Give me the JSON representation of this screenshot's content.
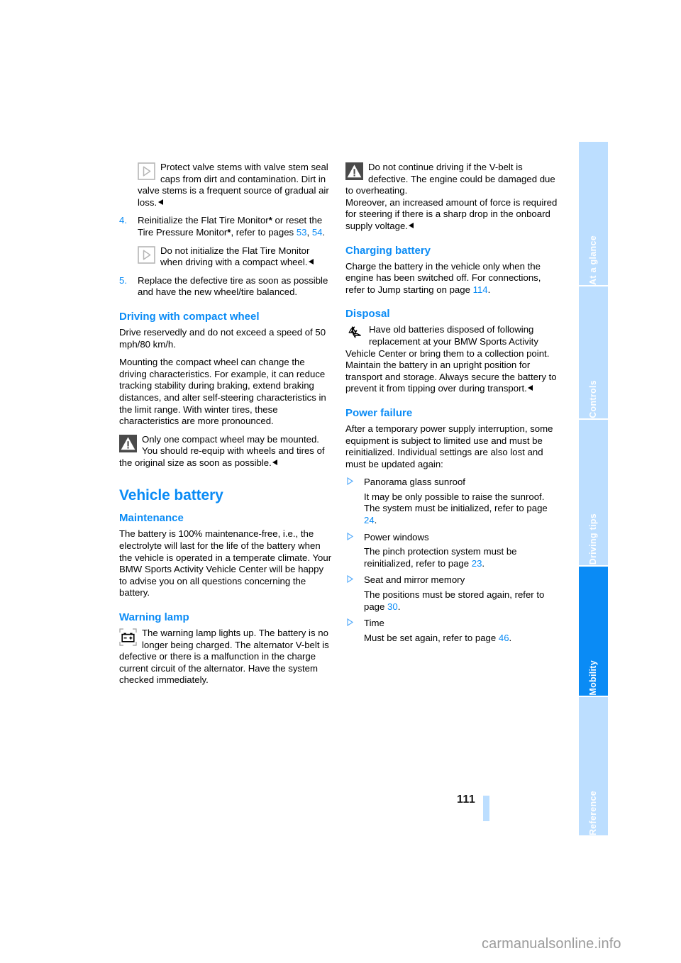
{
  "page": {
    "number": "111",
    "watermark": "carmanualsonline.info"
  },
  "colors": {
    "accent": "#0a8bf5",
    "tab_inactive": "#bcdeff",
    "tab_active": "#0a8bf5",
    "text": "#000000"
  },
  "sidebar": {
    "tabs": [
      {
        "label": "At a glance",
        "active": false
      },
      {
        "label": "Controls",
        "active": false
      },
      {
        "label": "Driving tips",
        "active": false
      },
      {
        "label": "Mobility",
        "active": true
      },
      {
        "label": "Reference",
        "active": false
      }
    ]
  },
  "left_column": {
    "note_valve_stems": {
      "icon": "note-triangle-icon",
      "text": "Protect valve stems with valve stem seal caps from dirt and contamination. Dirt in valve stems is a frequent source of gradual air loss."
    },
    "step4": {
      "number": "4.",
      "text_a": "Reinitialize the Flat Tire Monitor",
      "star": "*",
      "text_b": " or reset the Tire Pressure Monitor",
      "star2": "*",
      "text_c": ", refer to pages ",
      "page_ref_1": "53",
      "comma": ", ",
      "page_ref_2": "54",
      "period": "."
    },
    "note_no_init": {
      "icon": "note-triangle-icon",
      "text": "Do not initialize the Flat Tire Monitor when driving with a compact wheel."
    },
    "step5": {
      "number": "5.",
      "text": "Replace the defective tire as soon as possible and have the new wheel/tire balanced."
    },
    "heading_driving_compact": "Driving with compact wheel",
    "para_speed": "Drive reservedly and do not exceed a speed of 50 mph/80 km/h.",
    "para_mounting": "Mounting the compact wheel can change the driving characteristics. For example, it can reduce tracking stability during braking, extend braking distances, and alter self-steering characteristics in the limit range. With winter tires, these characteristics are more pronounced.",
    "warning_one_wheel": {
      "icon": "warning-triangle-icon",
      "text": "Only one compact wheel may be mounted. You should re-equip with wheels and tires of the original size as soon as possible."
    },
    "heading_vehicle_battery": "Vehicle battery",
    "heading_maintenance": "Maintenance",
    "para_maintenance": "The battery is 100% maintenance-free, i.e., the electrolyte will last for the life of the battery when the vehicle is operated in a temperate climate. Your BMW Sports Activity Vehicle Center will be happy to advise you on all questions concerning the battery.",
    "heading_warning_lamp": "Warning lamp",
    "warning_lamp_block": {
      "icon": "battery-warning-lamp-icon",
      "text": "The warning lamp lights up. The battery is no longer being charged. The alternator V-belt is defective or there is a malfunction in the charge current circuit of the alternator. Have the system checked immediately."
    }
  },
  "right_column": {
    "warning_vbelt": {
      "icon": "warning-triangle-icon",
      "text_a": "Do not continue driving if the V-belt is defective. The engine could be damaged due to overheating.",
      "text_b": "Moreover, an increased amount of force is required for steering if there is a sharp drop in the onboard supply voltage."
    },
    "heading_charging_battery": "Charging battery",
    "para_charging_a": "Charge the battery in the vehicle only when the engine has been switched off. For connections, refer to Jump starting on page ",
    "para_charging_page": "114",
    "para_charging_b": ".",
    "heading_disposal": "Disposal",
    "disposal_block": {
      "icon": "recycle-icon",
      "text": "Have old batteries disposed of following replacement at your BMW Sports Activity Vehicle Center or bring them to a collection point. Maintain the battery in an upright position for transport and storage. Always secure the battery to prevent it from tipping over during transport."
    },
    "heading_power_failure": "Power failure",
    "para_power_failure": "After a temporary power supply interruption, some equipment is subject to limited use and must be reinitialized. Individual settings are also lost and must be updated again:",
    "items": [
      {
        "title": "Panorama glass sunroof",
        "body_a": "It may be only possible to raise the sunroof. The system must be initialized, refer to page ",
        "page_ref": "24",
        "body_b": "."
      },
      {
        "title": "Power windows",
        "body_a": "The pinch protection system must be reinitialized, refer to page ",
        "page_ref": "23",
        "body_b": "."
      },
      {
        "title": "Seat and mirror memory",
        "body_a": "The positions must be stored again, refer to page ",
        "page_ref": "30",
        "body_b": "."
      },
      {
        "title": "Time",
        "body_a": "Must be set again, refer to page ",
        "page_ref": "46",
        "body_b": "."
      }
    ]
  }
}
